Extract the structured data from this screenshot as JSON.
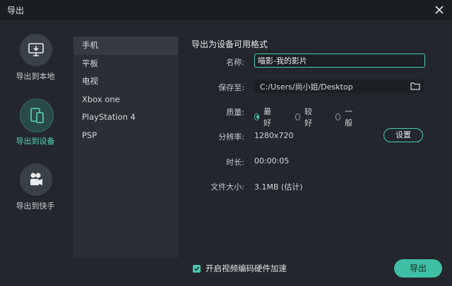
{
  "window": {
    "title": "导出"
  },
  "sidebar": {
    "items": [
      {
        "label": "导出到本地",
        "icon": "monitor-download-icon"
      },
      {
        "label": "导出到设备",
        "icon": "devices-icon",
        "active": true
      },
      {
        "label": "导出到快手",
        "icon": "film-camera-icon"
      }
    ]
  },
  "devices": {
    "items": [
      "手机",
      "平板",
      "电视",
      "Xbox one",
      "PlayStation 4",
      "PSP"
    ],
    "selected": "手机"
  },
  "form": {
    "title": "导出为设备可用格式",
    "name_label": "名称:",
    "name_value": "喵影-我的影片",
    "save_label": "保存至:",
    "save_path": "C:/Users/尚小姐/Desktop",
    "quality_label": "质量:",
    "quality_options": [
      "最好",
      "较好",
      "一般"
    ],
    "quality_selected": "最好",
    "resolution_label": "分辨率:",
    "resolution_value": "1280x720",
    "settings_button": "设置",
    "duration_label": "时长:",
    "duration_value": "00:00:05",
    "filesize_label": "文件大小:",
    "filesize_value": "3.1MB (估计)"
  },
  "footer": {
    "hw_accel_label": "开启视频编码硬件加速",
    "hw_accel_checked": true,
    "export_button": "导出"
  },
  "colors": {
    "accent": "#4cc9b0",
    "background": "#23272d",
    "titlebar": "#1a1d21"
  }
}
